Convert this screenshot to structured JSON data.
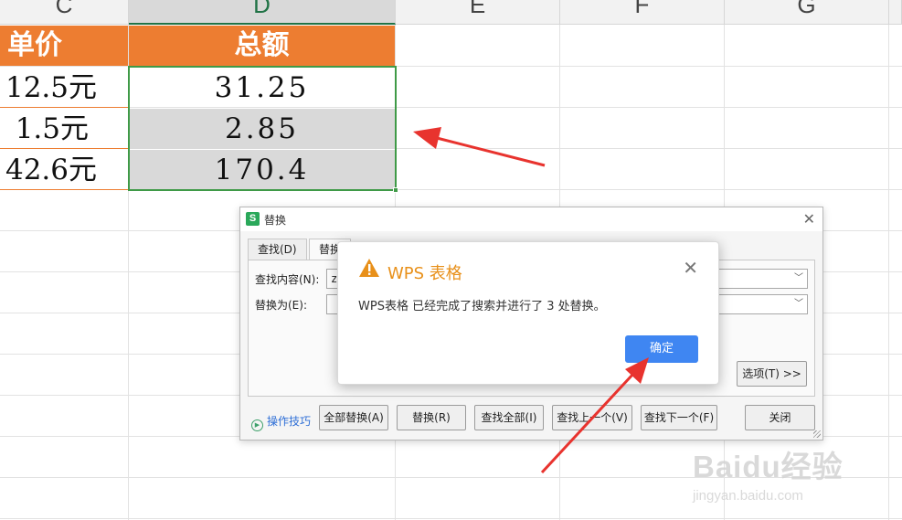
{
  "sheet": {
    "columns": [
      "C",
      "D",
      "E",
      "F",
      "G"
    ],
    "header_row": {
      "c": "单价",
      "d": "总额"
    },
    "rows": [
      {
        "c": "12.5元",
        "d": "31.25"
      },
      {
        "c": "1.5元",
        "d": "2.85"
      },
      {
        "c": "42.6元",
        "d": "170.4"
      }
    ],
    "colors": {
      "header_fill": "#ed7d31",
      "selection_border": "#3f9a47",
      "selected_fill": "#d9d9d9"
    }
  },
  "replace_dialog": {
    "icon": "S",
    "title": "替换",
    "tabs": [
      "查找(D)",
      "替换"
    ],
    "find_label": "查找内容(N):",
    "find_value": "z",
    "replace_label": "替换为(E):",
    "replace_value": "",
    "options_button": "选项(T) >>",
    "tips_link": "操作技巧",
    "buttons": [
      "全部替换(A)",
      "替换(R)",
      "查找全部(I)",
      "查找上一个(V)",
      "查找下一个(F)",
      "关闭"
    ]
  },
  "message_box": {
    "title": "WPS 表格",
    "text": "WPS表格 已经完成了搜索并进行了 3 处替换。",
    "ok_label": "确定",
    "accent": "#3f86f2",
    "warning_color": "#e8901a"
  },
  "watermark": {
    "main": "Baidu经验",
    "sub": "jingyan.baidu.com"
  },
  "annotation_color": "#e8332e"
}
